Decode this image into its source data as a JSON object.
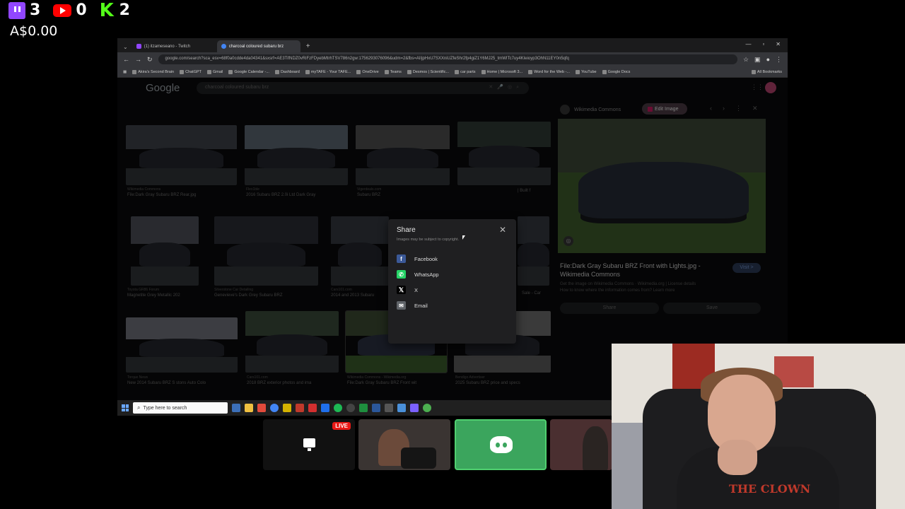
{
  "overlay": {
    "twitch_count": "3",
    "youtube_count": "0",
    "kick_logo": "K",
    "kick_count": "2",
    "money": "A$0.00"
  },
  "browser": {
    "tabs": [
      {
        "title": "(1) itzameseano - Twitch"
      },
      {
        "title": "charcoal coloured subaru brz"
      }
    ],
    "url": "google.com/search?sca_esv=68f0a0cdde4da04341&sxsrf=AE3TifNDZ0vRiFzFDyebMtrhTSV786n2gw:1756293076096&udm=2&fbs=AIIjpHxU7SXXniUZfeShr2fp4giZ1Y6MJ25_tmWITc7uy4KIeioyp3OhN11EY0n5qfq",
    "bookmarks": [
      "Akira's Second Brain",
      "ChatGPT",
      "Gmail",
      "Google Calendar -...",
      "Dashboard",
      "myTAFE - Your TAFE...",
      "OneDrive",
      "Teams",
      "Desmos | Scientific...",
      "car parts",
      "Home | Microsoft 3...",
      "Word for the Web -...",
      "YouTube",
      "Google Docs"
    ],
    "all_bookmarks": "All Bookmarks"
  },
  "google": {
    "logo": "Google",
    "query": "charcoal coloured subaru brz"
  },
  "results": [
    {
      "source": "Wikimedia Commons",
      "title": "File:Dark Gray Subaru BRZ Rear.jpg"
    },
    {
      "source": "Flex1ble",
      "title": "2016 Subaru BRZ 2.0i Ltd Dark Gray"
    },
    {
      "source": "Vigerdeals.com",
      "title": "Subaru BRZ"
    },
    {
      "source": "",
      "title": "| Built f"
    },
    {
      "source": "Toyota GR86 Forum",
      "title": "Magnetite Grey Metallic 202"
    },
    {
      "source": "Silverstone Car Detailing",
      "title": "Genevieve's Dark Grey Subaru BRZ"
    },
    {
      "source": "Cars101.com",
      "title": "2014 and 2013 Subaru"
    },
    {
      "source": "",
      "title": "Sale - Car"
    },
    {
      "source": "Torque News",
      "title": "New 2014 Subaru BRZ S stons Auto Colo"
    },
    {
      "source": "Cars101.com",
      "title": "2018 BRZ exterior photos and ima"
    },
    {
      "source": "Wikimedia Commons - Wikimedia.org",
      "title": "File:Dark Gray Subaru BRZ Front wit"
    },
    {
      "source": "Bendigo Advertiser",
      "title": "2025 Subaru BRZ price and specs"
    }
  ],
  "panel": {
    "source": "Wikimedia Commons",
    "edit_image": "Edit Image",
    "title": "File:Dark Gray Subaru BRZ Front with Lights.jpg - Wikimedia Commons",
    "visit": "Visit >",
    "meta": "Get the image on Wikimedia Commons · Wikimedia.org | License details",
    "meta2": "How to know where the information comes from? Learn more",
    "share": "Share",
    "save": "Save"
  },
  "share_dialog": {
    "title": "Share",
    "note": "Images may be subject to copyright.",
    "options": [
      {
        "label": "Facebook",
        "color": "#3b5998",
        "icon": "facebook-icon",
        "glyph": "f"
      },
      {
        "label": "WhatsApp",
        "color": "#25d366",
        "icon": "whatsapp-icon",
        "glyph": ""
      },
      {
        "label": "X",
        "color": "#000000",
        "icon": "x-icon",
        "glyph": "X"
      },
      {
        "label": "Email",
        "color": "#5f6368",
        "icon": "email-icon",
        "glyph": ""
      }
    ]
  },
  "taskbar": {
    "search_placeholder": "Type here to search"
  },
  "stream": {
    "live": "LIVE",
    "shirt_text": "THE CLOWN"
  }
}
